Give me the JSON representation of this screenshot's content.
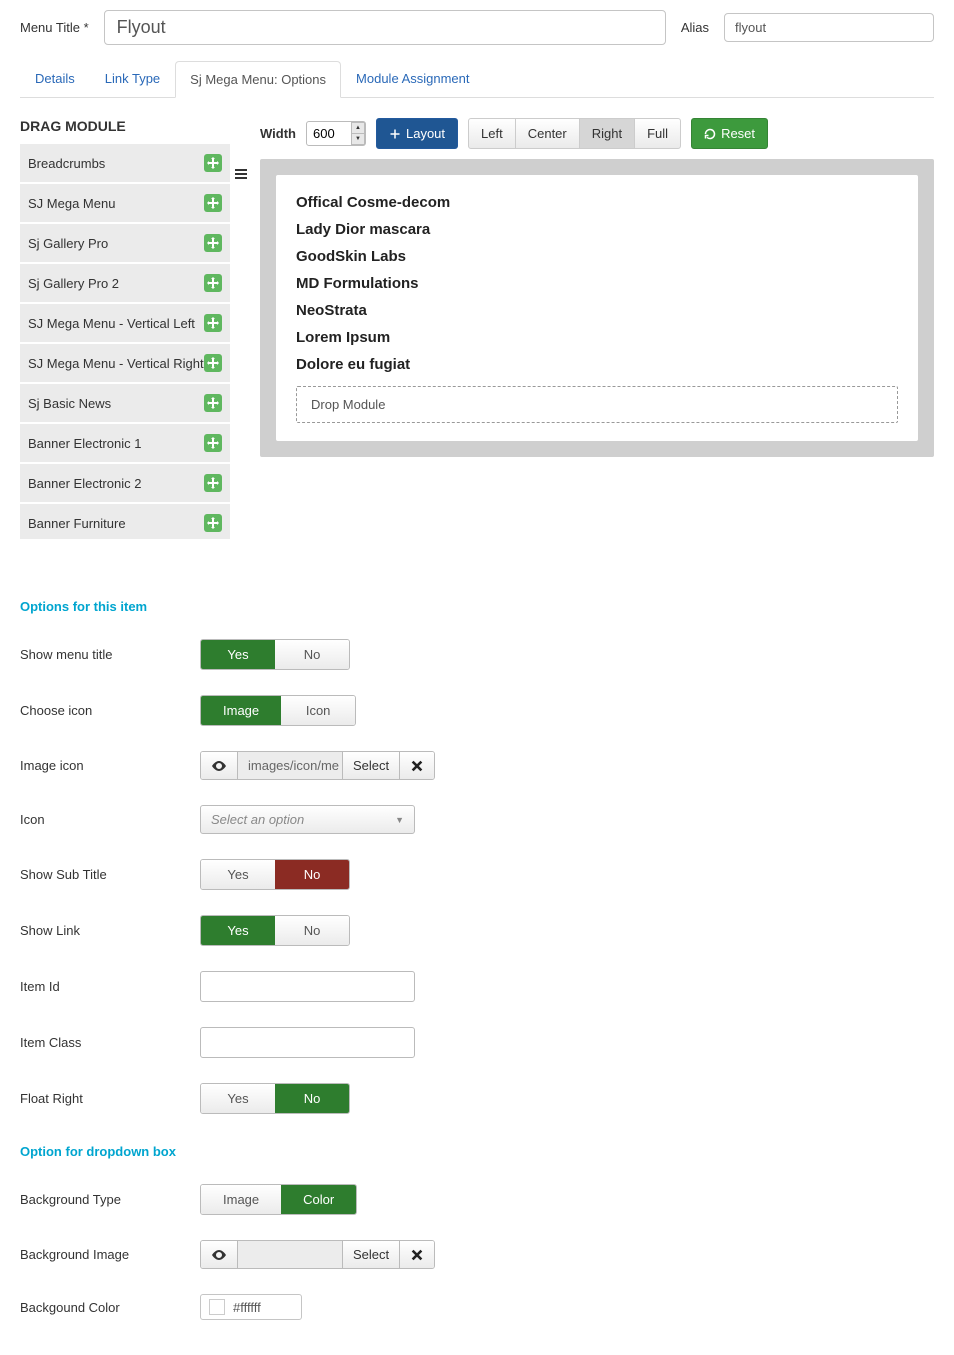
{
  "header": {
    "menu_title_label": "Menu Title *",
    "menu_title_value": "Flyout",
    "alias_label": "Alias",
    "alias_value": "flyout"
  },
  "tabs": {
    "details": "Details",
    "link_type": "Link Type",
    "options": "Sj Mega Menu: Options",
    "module_assignment": "Module Assignment"
  },
  "drag_module_label": "DRAG MODULE",
  "modules": [
    "Breadcrumbs",
    "SJ Mega Menu",
    "Sj Gallery Pro",
    "Sj Gallery Pro 2",
    "SJ Mega Menu - Vertical Left",
    "SJ Mega Menu - Vertical Right",
    "Sj Basic News",
    "Banner Electronic 1",
    "Banner Electronic 2",
    "Banner Furniture"
  ],
  "toolbar": {
    "width_label": "Width",
    "width_value": "600",
    "layout_btn": "Layout",
    "align": {
      "left": "Left",
      "center": "Center",
      "right": "Right",
      "full": "Full"
    },
    "reset_btn": "Reset"
  },
  "preview_lines": [
    "Offical Cosme-decom",
    "Lady Dior mascara",
    "GoodSkin Labs",
    "MD Formulations",
    "NeoStrata",
    "Lorem Ipsum",
    "Dolore eu fugiat"
  ],
  "drop_module": "Drop Module",
  "options_section": "Options for this item",
  "opts": {
    "show_menu_title": "Show menu title",
    "choose_icon": "Choose icon",
    "image_icon": "Image icon",
    "icon": "Icon",
    "show_sub_title": "Show Sub Title",
    "show_link": "Show Link",
    "item_id": "Item Id",
    "item_class": "Item Class",
    "float_right": "Float Right"
  },
  "dropdown_section": "Option for dropdown box",
  "dd": {
    "bg_type": "Background Type",
    "bg_image": "Background Image",
    "bg_color": "Backgound Color"
  },
  "toggle": {
    "yes": "Yes",
    "no": "No",
    "image": "Image",
    "icon": "Icon",
    "color": "Color"
  },
  "input_group": {
    "img_path": "images/icon/me",
    "select": "Select"
  },
  "select_placeholder": "Select an option",
  "color_value": "#ffffff"
}
